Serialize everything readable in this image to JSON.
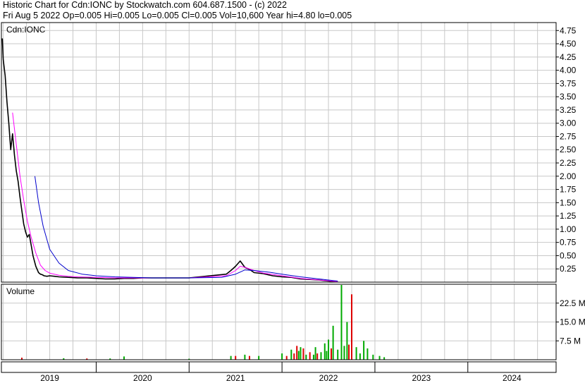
{
  "header": {
    "line1": "Historic Chart for Cdn:IONC by Stockwatch.com 604.687.1500 - (c) 2022",
    "line2": "Fri Aug  5 2022  Op=0.005  Hi=0.005  Lo=0.005  Cl=0.005  Vol=10,600  Year hi=4.80  lo=0.005"
  },
  "colors": {
    "price": "#000000",
    "ma_short": "#ff00ff",
    "ma_long": "#0000cc",
    "vol_up": "#00aa00",
    "vol_down": "#dd0000",
    "grid": "#c8c8c8",
    "frame": "#000000"
  },
  "chart_data": [
    {
      "type": "line",
      "title": "Cdn:IONC",
      "ylim": [
        0,
        4.9
      ],
      "yticks": [
        0.25,
        0.5,
        0.75,
        1.0,
        1.25,
        1.5,
        1.75,
        2.0,
        2.25,
        2.5,
        2.75,
        3.0,
        3.25,
        3.5,
        3.75,
        4.0,
        4.25,
        4.5,
        4.75
      ],
      "ytick_labels": [
        "0.25",
        "0.50",
        "0.75",
        "1.00",
        "1.25",
        "1.50",
        "1.75",
        "2.00",
        "2.25",
        "2.50",
        "2.75",
        "3.00",
        "3.25",
        "3.50",
        "3.75",
        "4.00",
        "4.25",
        "4.50",
        "4.75"
      ],
      "xlim": [
        2018.48,
        2024.45
      ],
      "x_ticks": [
        2019,
        2020,
        2021,
        2022,
        2023,
        2024
      ],
      "x_tick_labels": [
        "2019",
        "2020",
        "2021",
        "2022",
        "2023",
        "2024"
      ],
      "series": [
        {
          "key": "price",
          "x": [
            2018.49,
            2018.5,
            2018.52,
            2018.54,
            2018.56,
            2018.58,
            2018.6,
            2018.62,
            2018.64,
            2018.66,
            2018.68,
            2018.7,
            2018.72,
            2018.74,
            2018.76,
            2018.78,
            2018.8,
            2018.82,
            2018.85,
            2018.88,
            2018.9,
            2018.92,
            2018.94,
            2018.97,
            2019.0,
            2019.05,
            2019.1,
            2019.2,
            2019.3,
            2019.4,
            2019.5,
            2019.6,
            2019.7,
            2019.8,
            2019.9,
            2020.0,
            2020.05,
            2020.1,
            2020.5,
            2020.9,
            2020.95,
            2021.0,
            2021.05,
            2021.1,
            2021.15,
            2021.2,
            2021.3,
            2021.4,
            2021.5,
            2021.6,
            2021.7,
            2021.8,
            2021.9,
            2022.0,
            2022.05,
            2022.1
          ],
          "y": [
            4.6,
            4.2,
            3.9,
            3.4,
            3.0,
            2.5,
            2.8,
            2.4,
            2.1,
            1.9,
            1.6,
            1.35,
            1.1,
            0.95,
            0.85,
            0.9,
            0.7,
            0.5,
            0.3,
            0.18,
            0.15,
            0.14,
            0.12,
            0.11,
            0.12,
            0.11,
            0.1,
            0.09,
            0.08,
            0.08,
            0.07,
            0.06,
            0.06,
            0.07,
            0.07,
            0.08,
            0.08,
            0.08,
            0.08,
            0.15,
            0.22,
            0.3,
            0.4,
            0.28,
            0.24,
            0.18,
            0.16,
            0.12,
            0.1,
            0.09,
            0.06,
            0.05,
            0.04,
            0.02,
            0.01,
            0.005
          ]
        },
        {
          "key": "ma_short",
          "x": [
            2018.6,
            2018.64,
            2018.68,
            2018.72,
            2018.76,
            2018.8,
            2018.85,
            2018.9,
            2018.95,
            2019.0,
            2019.1,
            2019.2,
            2019.3,
            2019.5,
            2019.7,
            2019.9,
            2020.1,
            2020.5,
            2020.9,
            2021.0,
            2021.05,
            2021.1,
            2021.2,
            2021.3,
            2021.5,
            2021.7,
            2021.9,
            2022.1
          ],
          "y": [
            3.2,
            2.6,
            2.0,
            1.55,
            1.15,
            0.85,
            0.55,
            0.32,
            0.22,
            0.17,
            0.13,
            0.11,
            0.1,
            0.09,
            0.08,
            0.08,
            0.08,
            0.08,
            0.12,
            0.22,
            0.3,
            0.28,
            0.22,
            0.17,
            0.12,
            0.07,
            0.04,
            0.01
          ]
        },
        {
          "key": "ma_long",
          "x": [
            2018.84,
            2018.88,
            2018.93,
            2019.0,
            2019.1,
            2019.2,
            2019.35,
            2019.5,
            2019.7,
            2019.9,
            2020.1,
            2020.5,
            2020.85,
            2021.0,
            2021.1,
            2021.2,
            2021.35,
            2021.5,
            2021.7,
            2021.9,
            2022.1
          ],
          "y": [
            2.0,
            1.5,
            1.05,
            0.62,
            0.36,
            0.22,
            0.15,
            0.12,
            0.1,
            0.09,
            0.08,
            0.08,
            0.09,
            0.15,
            0.23,
            0.22,
            0.19,
            0.15,
            0.1,
            0.06,
            0.02
          ]
        }
      ]
    },
    {
      "type": "bar",
      "title": "Volume",
      "ylim": [
        0,
        30
      ],
      "yticks": [
        7.5,
        15,
        22.5
      ],
      "ytick_labels": [
        "7.5 M",
        "15.0 M",
        "22.5 M"
      ],
      "xlim": [
        2018.48,
        2024.45
      ],
      "bars": [
        {
          "x": 2018.7,
          "v": 0.8,
          "dir": "down"
        },
        {
          "x": 2019.15,
          "v": 0.6,
          "dir": "up"
        },
        {
          "x": 2019.4,
          "v": 0.5,
          "dir": "down"
        },
        {
          "x": 2019.65,
          "v": 0.5,
          "dir": "up"
        },
        {
          "x": 2019.8,
          "v": 1.3,
          "dir": "up"
        },
        {
          "x": 2020.5,
          "v": 0.4,
          "dir": "up"
        },
        {
          "x": 2020.95,
          "v": 1.5,
          "dir": "up"
        },
        {
          "x": 2021.0,
          "v": 1.5,
          "dir": "down"
        },
        {
          "x": 2021.1,
          "v": 2.0,
          "dir": "up"
        },
        {
          "x": 2021.15,
          "v": 1.5,
          "dir": "down"
        },
        {
          "x": 2021.25,
          "v": 1.5,
          "dir": "up"
        },
        {
          "x": 2021.5,
          "v": 2.5,
          "dir": "up"
        },
        {
          "x": 2021.55,
          "v": 1.5,
          "dir": "down"
        },
        {
          "x": 2021.6,
          "v": 4.0,
          "dir": "up"
        },
        {
          "x": 2021.63,
          "v": 2.5,
          "dir": "down"
        },
        {
          "x": 2021.66,
          "v": 5.5,
          "dir": "down"
        },
        {
          "x": 2021.68,
          "v": 3.5,
          "dir": "up"
        },
        {
          "x": 2021.7,
          "v": 5.0,
          "dir": "up"
        },
        {
          "x": 2021.73,
          "v": 4.5,
          "dir": "down"
        },
        {
          "x": 2021.76,
          "v": 2.0,
          "dir": "up"
        },
        {
          "x": 2021.8,
          "v": 3.0,
          "dir": "down"
        },
        {
          "x": 2021.84,
          "v": 2.0,
          "dir": "up"
        },
        {
          "x": 2021.86,
          "v": 5.0,
          "dir": "up"
        },
        {
          "x": 2021.88,
          "v": 2.5,
          "dir": "down"
        },
        {
          "x": 2021.92,
          "v": 3.0,
          "dir": "up"
        },
        {
          "x": 2021.96,
          "v": 6.5,
          "dir": "up"
        },
        {
          "x": 2021.98,
          "v": 3.5,
          "dir": "up"
        },
        {
          "x": 2022.0,
          "v": 8.0,
          "dir": "up"
        },
        {
          "x": 2022.03,
          "v": 4.5,
          "dir": "down"
        },
        {
          "x": 2022.05,
          "v": 13.5,
          "dir": "up"
        },
        {
          "x": 2022.1,
          "v": 4.0,
          "dir": "up"
        },
        {
          "x": 2022.14,
          "v": 33.0,
          "dir": "up"
        },
        {
          "x": 2022.17,
          "v": 5.5,
          "dir": "up"
        },
        {
          "x": 2022.2,
          "v": 15.0,
          "dir": "up"
        },
        {
          "x": 2022.22,
          "v": 6.0,
          "dir": "down"
        },
        {
          "x": 2022.25,
          "v": 26.0,
          "dir": "down"
        },
        {
          "x": 2022.3,
          "v": 5.0,
          "dir": "up"
        },
        {
          "x": 2022.34,
          "v": 2.5,
          "dir": "up"
        },
        {
          "x": 2022.38,
          "v": 7.5,
          "dir": "up"
        },
        {
          "x": 2022.42,
          "v": 4.5,
          "dir": "up"
        },
        {
          "x": 2022.48,
          "v": 2.0,
          "dir": "up"
        },
        {
          "x": 2022.55,
          "v": 1.5,
          "dir": "up"
        },
        {
          "x": 2022.6,
          "v": 1.0,
          "dir": "up"
        }
      ]
    }
  ]
}
